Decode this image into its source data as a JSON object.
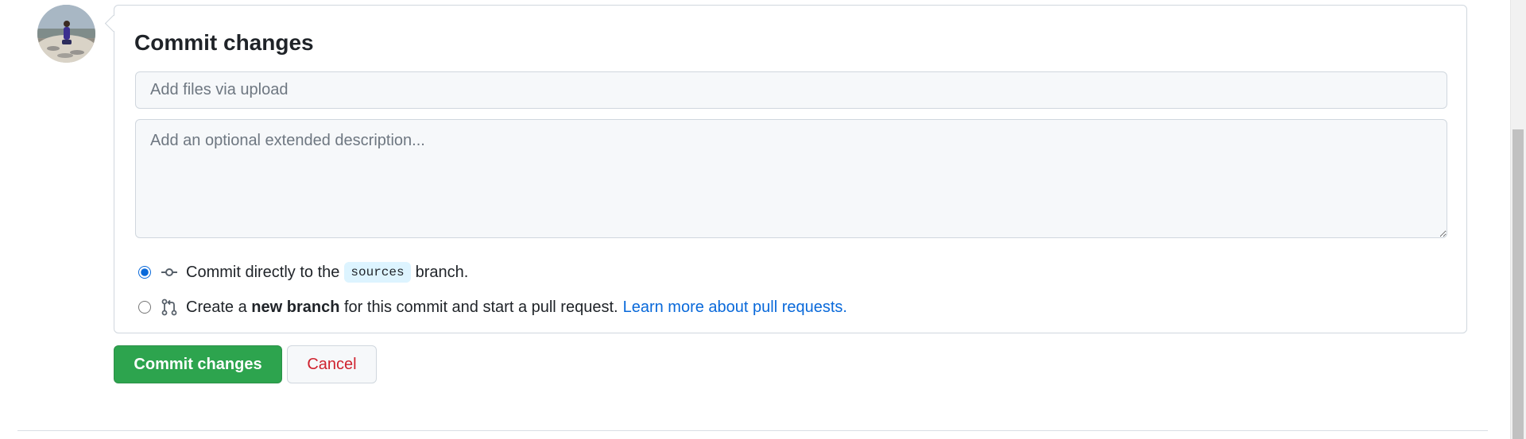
{
  "commit_form": {
    "title": "Commit changes",
    "summary_placeholder": "Add files via upload",
    "description_placeholder": "Add an optional extended description...",
    "options": {
      "direct": {
        "selected": true,
        "icon": "git-commit-icon",
        "prefix": "Commit directly to the",
        "branch": "sources",
        "suffix": "branch."
      },
      "new_branch": {
        "selected": false,
        "icon": "git-pull-request-icon",
        "prefix": "Create a",
        "bold": "new branch",
        "suffix": "for this commit and start a pull request.",
        "link": "Learn more about pull requests."
      }
    },
    "buttons": {
      "commit": "Commit changes",
      "cancel": "Cancel"
    }
  },
  "colors": {
    "primary_button": "#2da44e",
    "cancel_text": "#cf222e",
    "link": "#0969da",
    "branch_chip_bg": "#ddf4ff",
    "input_bg": "#f6f8fa",
    "border": "#d0d7de"
  }
}
